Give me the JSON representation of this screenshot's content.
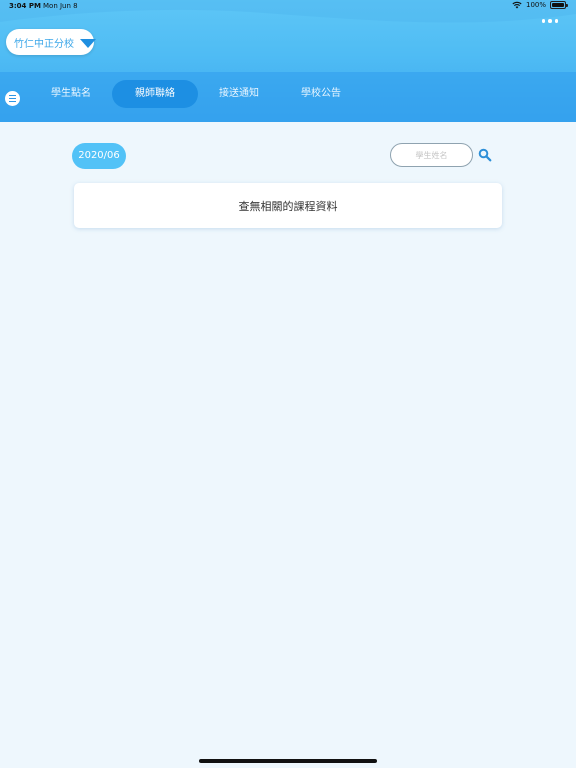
{
  "status_bar": {
    "time": "3:04 PM",
    "date": "Mon Jun 8",
    "battery": "100%",
    "icons": [
      "wifi-icon",
      "battery-icon"
    ]
  },
  "header": {
    "school": "竹仁中正分校",
    "more_icon": "more-dots-icon"
  },
  "nav": {
    "menu_icon": "hamburger-menu-icon",
    "tabs": [
      {
        "label": "學生點名",
        "active": false
      },
      {
        "label": "親師聯絡",
        "active": true
      },
      {
        "label": "接送通知",
        "active": false
      },
      {
        "label": "學校公告",
        "active": false
      }
    ]
  },
  "filter": {
    "month": "2020/06",
    "search_placeholder": "學生姓名",
    "search_value": "",
    "search_icon": "magnifier-icon"
  },
  "empty_message": "查無相關的課程資料",
  "colors": {
    "header_top": "#5ec6f6",
    "header_bottom": "#3ba7ef",
    "active_tab": "#1d8fe3",
    "pill": "#52c2f7",
    "background": "#eef7fd",
    "accent_text": "#3aa6e8"
  }
}
